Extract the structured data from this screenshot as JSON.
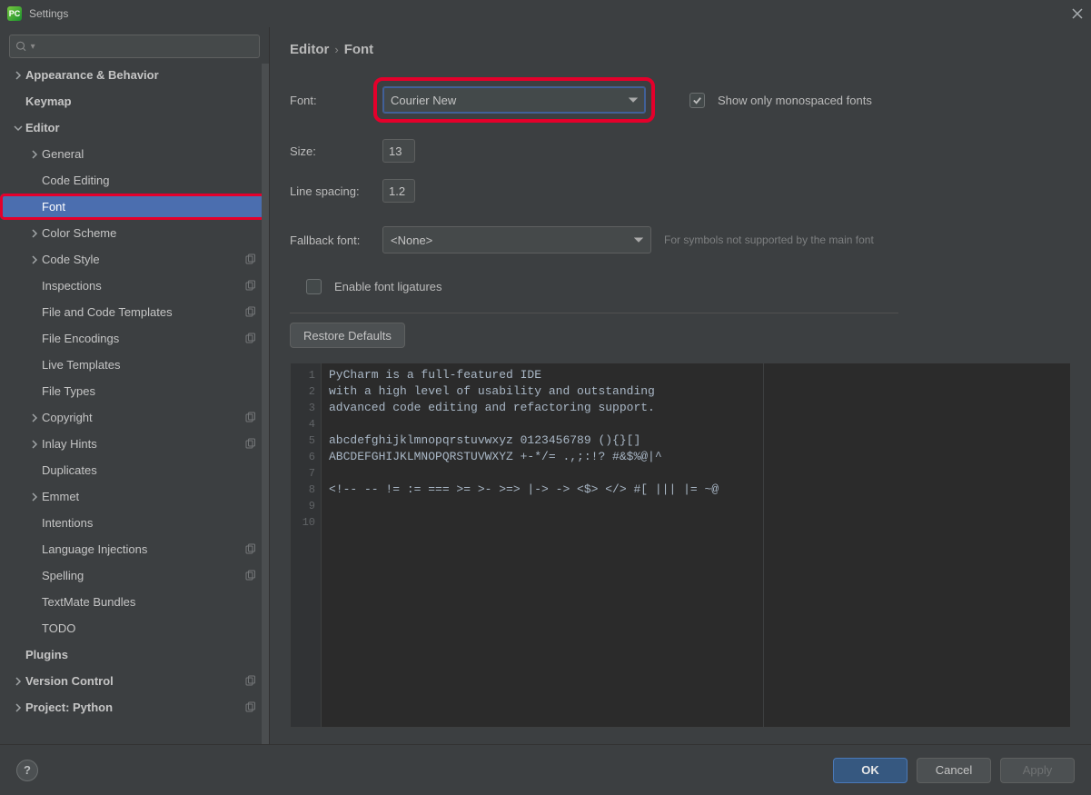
{
  "window": {
    "title": "Settings"
  },
  "sidebar": {
    "search_placeholder": "",
    "items": [
      {
        "label": "Appearance & Behavior",
        "level": 0,
        "arrow": "right",
        "bold": true
      },
      {
        "label": "Keymap",
        "level": 0,
        "arrow": "",
        "bold": true
      },
      {
        "label": "Editor",
        "level": 0,
        "arrow": "down",
        "bold": true
      },
      {
        "label": "General",
        "level": 1,
        "arrow": "right"
      },
      {
        "label": "Code Editing",
        "level": 1,
        "arrow": ""
      },
      {
        "label": "Font",
        "level": 1,
        "arrow": "",
        "selected": true,
        "highlight": true
      },
      {
        "label": "Color Scheme",
        "level": 1,
        "arrow": "right"
      },
      {
        "label": "Code Style",
        "level": 1,
        "arrow": "right",
        "copy": true
      },
      {
        "label": "Inspections",
        "level": 1,
        "arrow": "",
        "copy": true
      },
      {
        "label": "File and Code Templates",
        "level": 1,
        "arrow": "",
        "copy": true
      },
      {
        "label": "File Encodings",
        "level": 1,
        "arrow": "",
        "copy": true
      },
      {
        "label": "Live Templates",
        "level": 1,
        "arrow": ""
      },
      {
        "label": "File Types",
        "level": 1,
        "arrow": ""
      },
      {
        "label": "Copyright",
        "level": 1,
        "arrow": "right",
        "copy": true
      },
      {
        "label": "Inlay Hints",
        "level": 1,
        "arrow": "right",
        "copy": true
      },
      {
        "label": "Duplicates",
        "level": 1,
        "arrow": ""
      },
      {
        "label": "Emmet",
        "level": 1,
        "arrow": "right"
      },
      {
        "label": "Intentions",
        "level": 1,
        "arrow": ""
      },
      {
        "label": "Language Injections",
        "level": 1,
        "arrow": "",
        "copy": true
      },
      {
        "label": "Spelling",
        "level": 1,
        "arrow": "",
        "copy": true
      },
      {
        "label": "TextMate Bundles",
        "level": 1,
        "arrow": ""
      },
      {
        "label": "TODO",
        "level": 1,
        "arrow": ""
      },
      {
        "label": "Plugins",
        "level": 0,
        "arrow": "",
        "bold": true
      },
      {
        "label": "Version Control",
        "level": 0,
        "arrow": "right",
        "bold": true,
        "copy": true
      },
      {
        "label": "Project: Python",
        "level": 0,
        "arrow": "right",
        "bold": true,
        "copy": true
      }
    ]
  },
  "breadcrumb": {
    "a": "Editor",
    "b": "Font"
  },
  "form": {
    "font_label": "Font:",
    "font_value": "Courier New",
    "mono_label": "Show only monospaced fonts",
    "mono_checked": true,
    "size_label": "Size:",
    "size_value": "13",
    "spacing_label": "Line spacing:",
    "spacing_value": "1.2",
    "fallback_label": "Fallback font:",
    "fallback_value": "<None>",
    "fallback_hint": "For symbols not supported by the main font",
    "ligatures_label": "Enable font ligatures",
    "ligatures_checked": false,
    "restore_label": "Restore Defaults"
  },
  "preview": {
    "lines": [
      "PyCharm is a full-featured IDE",
      "with a high level of usability and outstanding",
      "advanced code editing and refactoring support.",
      "",
      "abcdefghijklmnopqrstuvwxyz 0123456789 (){}[]",
      "ABCDEFGHIJKLMNOPQRSTUVWXYZ +-*/= .,;:!? #&$%@|^",
      "",
      "<!-- -- != := === >= >- >=> |-> -> <$> </> #[ ||| |= ~@",
      "",
      ""
    ]
  },
  "footer": {
    "ok": "OK",
    "cancel": "Cancel",
    "apply": "Apply"
  }
}
